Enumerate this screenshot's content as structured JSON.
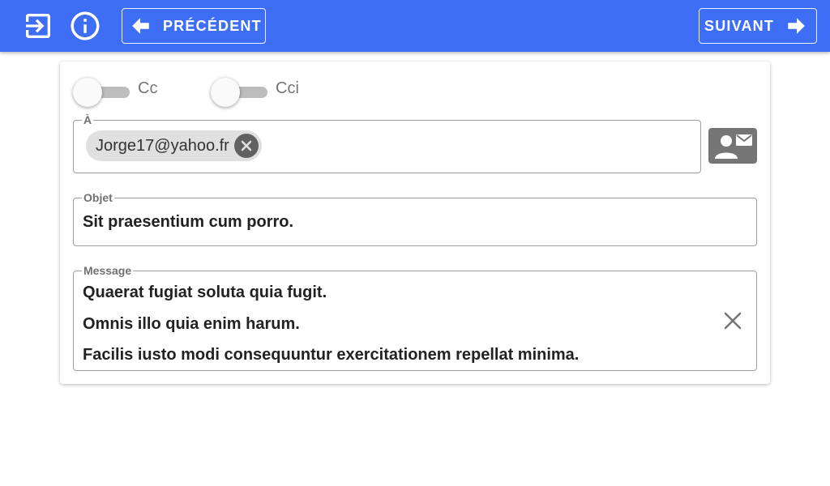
{
  "header": {
    "prev_label": "PRÉCÉDENT",
    "next_label": "SUIVANT",
    "icons": [
      "logout-icon",
      "info-icon",
      "arrow-left-icon",
      "arrow-right-icon"
    ],
    "accent_color": "#3d6ef5"
  },
  "toggles": [
    {
      "label": "Cc",
      "on": false
    },
    {
      "label": "Cci",
      "on": false
    }
  ],
  "to_field": {
    "legend": "À",
    "chips": [
      "Jorge17@yahoo.fr"
    ]
  },
  "subject_field": {
    "legend": "Objet",
    "value": "Sit praesentium cum porro."
  },
  "message_field": {
    "legend": "Message",
    "lines": [
      "Quaerat fugiat soluta quia fugit.",
      "Omnis illo quia enim harum.",
      "Facilis iusto modi consequuntur exercitationem repellat minima."
    ]
  }
}
